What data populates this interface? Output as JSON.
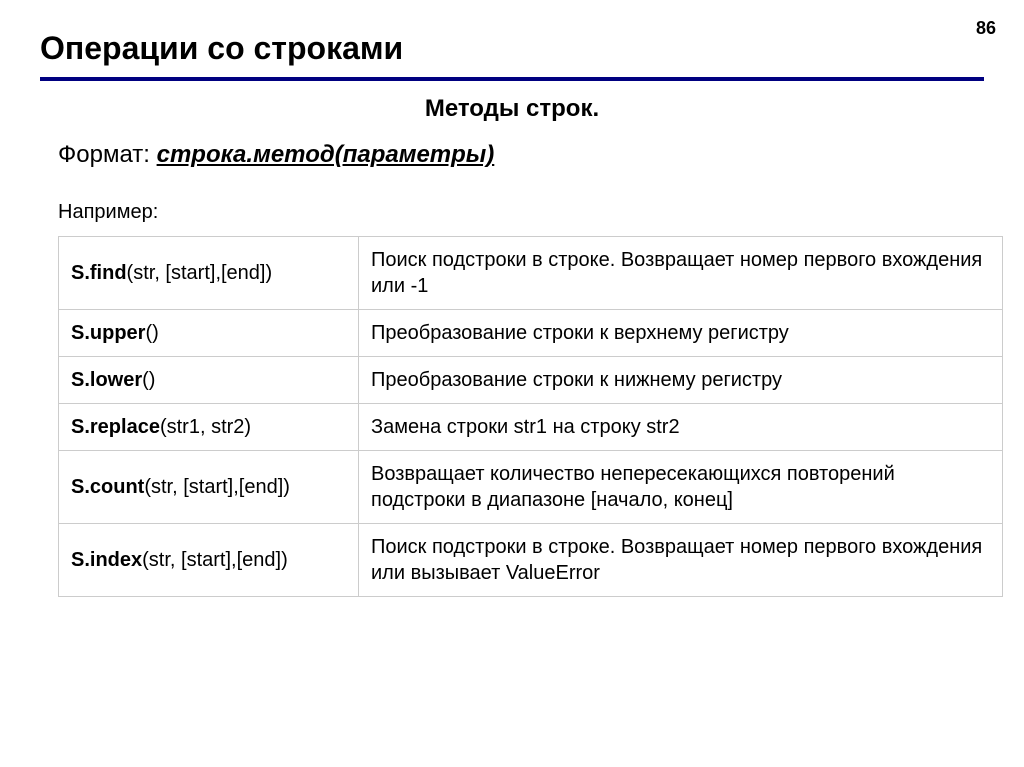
{
  "page_number": "86",
  "title": "Операции со строками",
  "subtitle": "Методы строк.",
  "format_label": "Формат: ",
  "format_value": "строка.метод(параметры)",
  "example_label": "Например:",
  "rows": [
    {
      "method_bold": "S.find",
      "method_args": "(str, [start],[end])",
      "desc": "Поиск подстроки в строке. Возвращает номер первого вхождения или -1"
    },
    {
      "method_bold": "S.upper",
      "method_args": "()",
      "desc": "Преобразование строки к верхнему регистру"
    },
    {
      "method_bold": "S.lower",
      "method_args": "()",
      "desc": "Преобразование строки к нижнему регистру"
    },
    {
      "method_bold": "S.replace",
      "method_args": "(str1, str2)",
      "desc": "Замена строки str1 на строку str2"
    },
    {
      "method_bold": "S.count",
      "method_args": "(str, [start],[end])",
      "desc": "Возвращает количество непересекающихся повторений подстроки в диапазоне [начало, конец]"
    },
    {
      "method_bold": "S.index",
      "method_args": "(str, [start],[end])",
      "desc": "Поиск подстроки в строке. Возвращает номер первого вхождения или вызывает ValueError"
    }
  ]
}
